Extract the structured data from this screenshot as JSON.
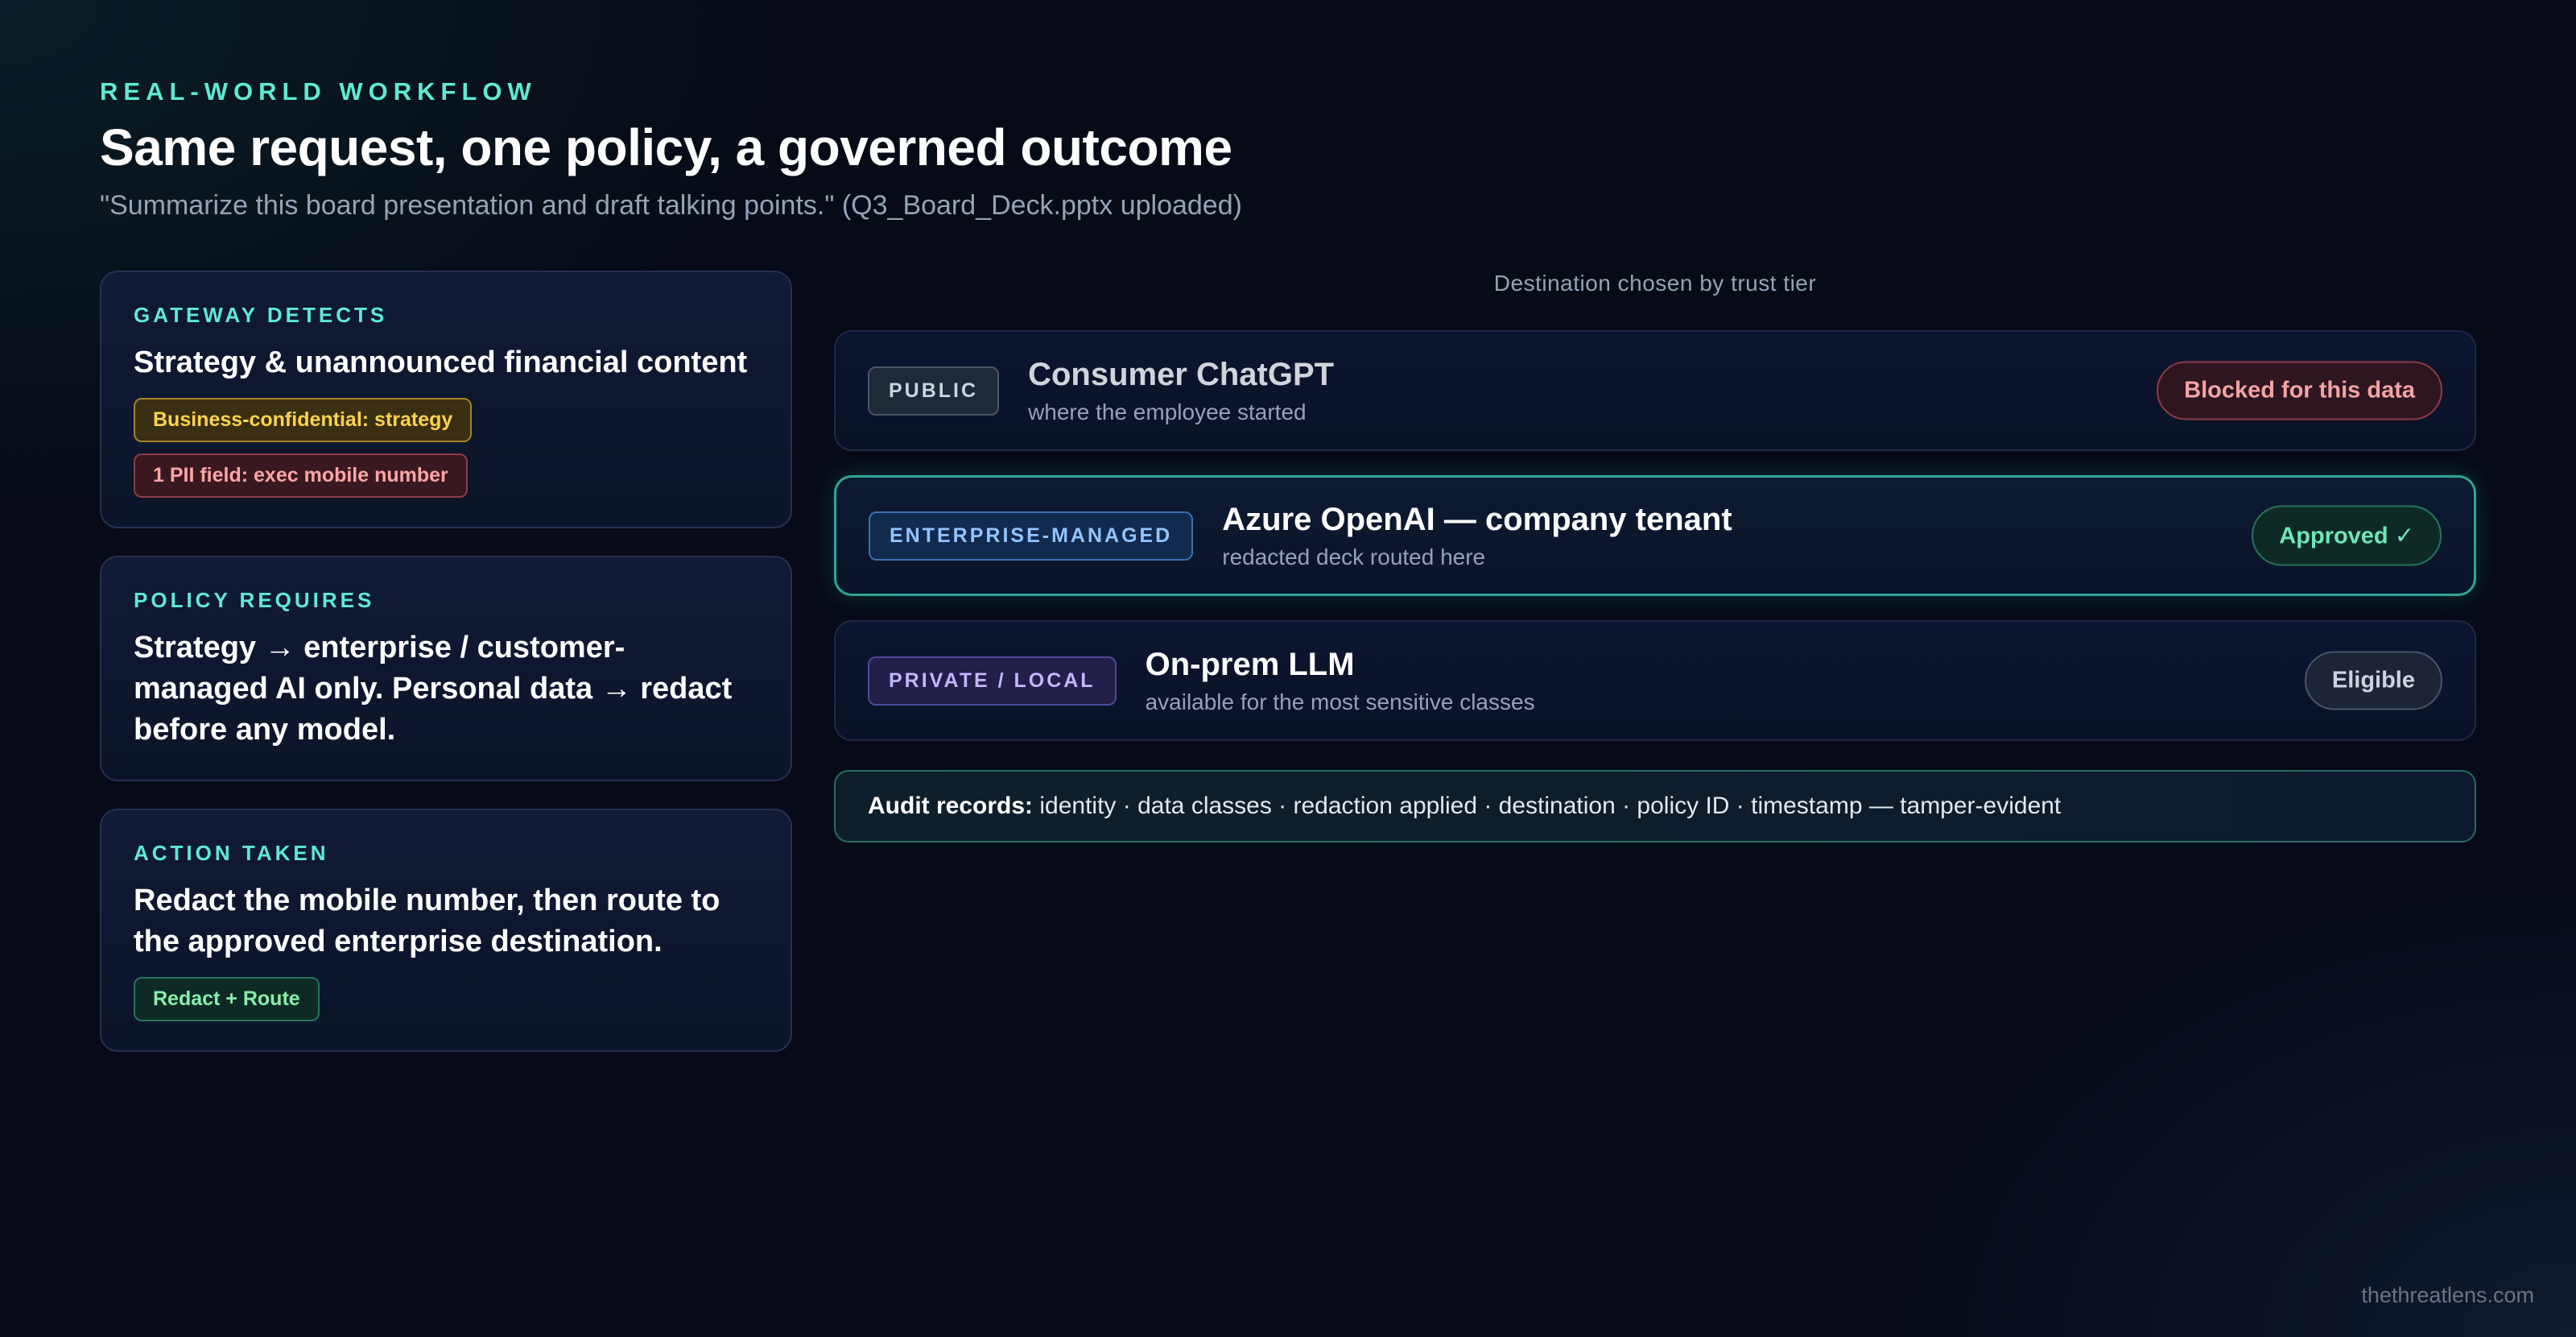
{
  "header": {
    "eyebrow": "REAL-WORLD WORKFLOW",
    "title": "Same request, one policy, a governed outcome",
    "subtitle": "\"Summarize this board presentation and draft talking points.\" (Q3_Board_Deck.pptx uploaded)"
  },
  "cards": {
    "detects": {
      "label": "GATEWAY DETECTS",
      "text": "Strategy & unannounced financial content",
      "tags": [
        "Business-confidential: strategy",
        "1 PII field: exec mobile number"
      ]
    },
    "policy": {
      "label": "POLICY REQUIRES",
      "text": "Strategy → enterprise / customer-managed AI only. Personal data → redact before any model."
    },
    "action": {
      "label": "ACTION TAKEN",
      "text": "Redact the mobile number, then route to the approved enterprise destination.",
      "tag": "Redact + Route"
    }
  },
  "destinations": {
    "header": "Destination chosen by trust tier",
    "items": [
      {
        "tier": "PUBLIC",
        "name": "Consumer ChatGPT",
        "note": "where the employee started",
        "status": "Blocked for this data"
      },
      {
        "tier": "ENTERPRISE-MANAGED",
        "name": "Azure OpenAI — company tenant",
        "note": "redacted deck routed here",
        "status": "Approved ✓"
      },
      {
        "tier": "PRIVATE / LOCAL",
        "name": "On-prem LLM",
        "note": "available for the most sensitive classes",
        "status": "Eligible"
      }
    ]
  },
  "audit": {
    "label": "Audit records:",
    "text": "identity · data classes · redaction applied · destination · policy ID · timestamp — tamper-evident"
  },
  "footer": {
    "brand": "thethreatlens.com"
  },
  "colors": {
    "accent": "#5eead4",
    "blocked": "#f4a3a3",
    "approved": "#6ee7b7",
    "background": "#060b17"
  }
}
